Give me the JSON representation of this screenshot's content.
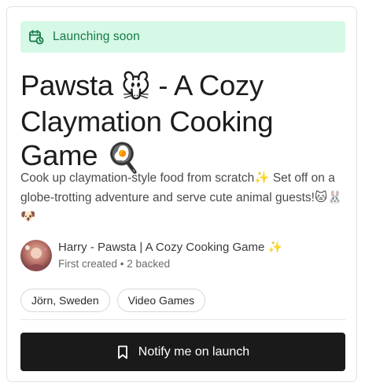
{
  "banner": {
    "text": "Launching soon",
    "icon": "calendar-clock-icon",
    "bg_color": "#d6f8e6",
    "text_color": "#157a47"
  },
  "product": {
    "title_part1": "Pawsta ",
    "title_emoji1": "🐭",
    "title_part2": " - A Cozy Claymation Cooking Game ",
    "title_emoji2": "🍳",
    "desc_part1": "Cook up claymation-style food from scratch",
    "desc_emoji1": "✨",
    "desc_part2": " Set off on a globe-trotting adventure and serve cute animal guests!",
    "desc_emoji2": "🐱🐰🐶"
  },
  "maker": {
    "name": "Harry - Pawsta | A Cozy Cooking Game ",
    "name_emoji": "✨",
    "meta_first": "First created",
    "meta_sep": "•",
    "meta_backed": "2 backed"
  },
  "tags": [
    "Jörn, Sweden",
    "Video Games"
  ],
  "cta": {
    "label": "Notify me on launch",
    "icon": "bookmark-icon",
    "bg_color": "#1a1a1a"
  }
}
